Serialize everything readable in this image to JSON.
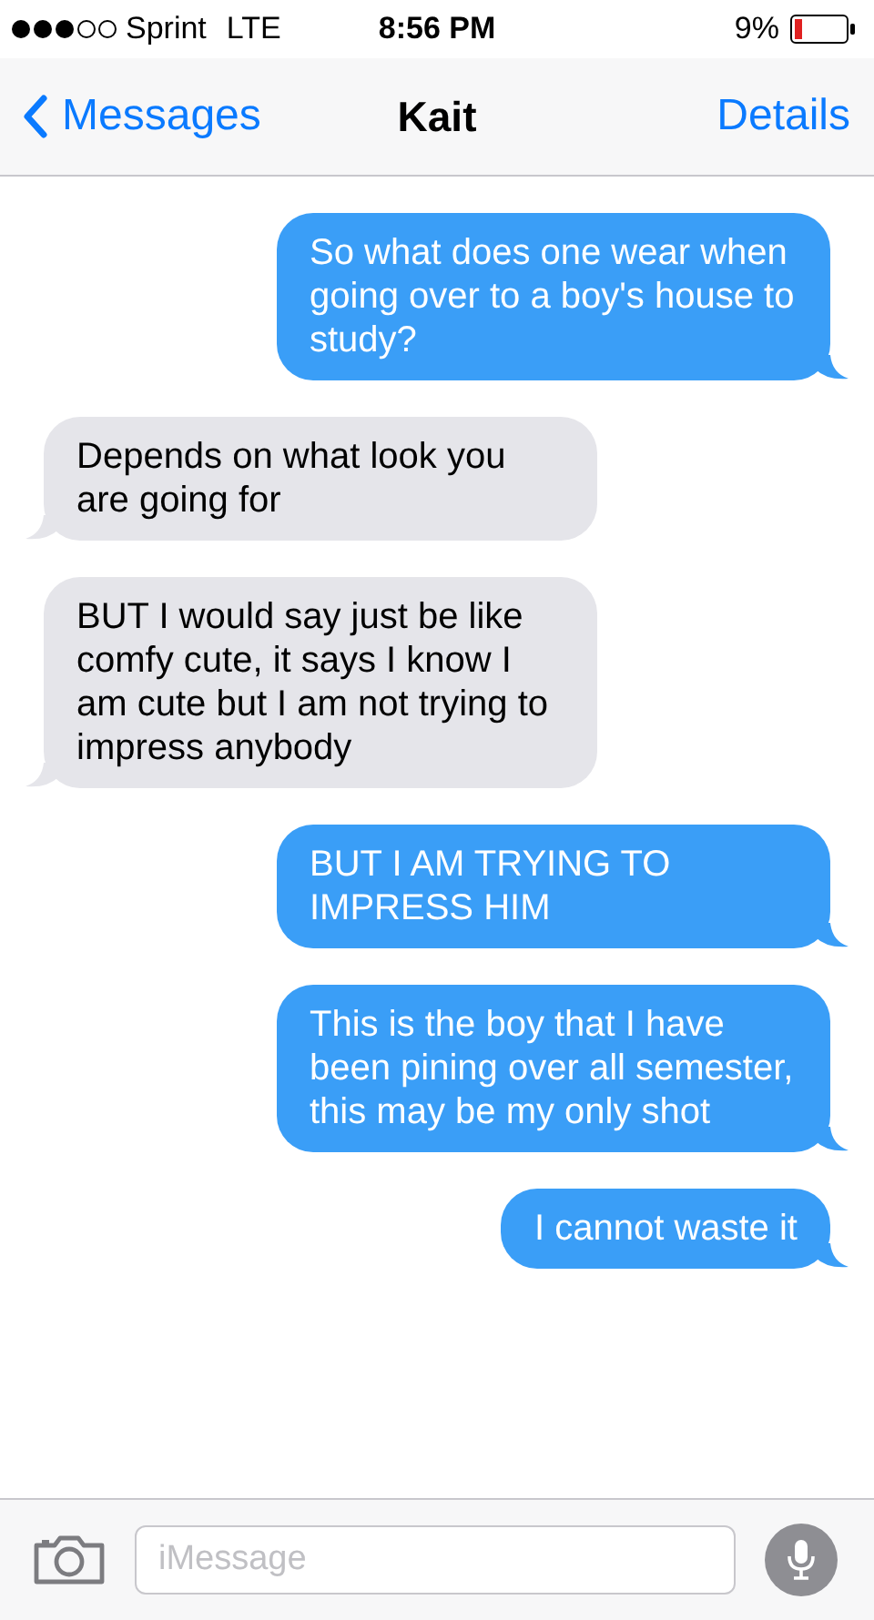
{
  "status_bar": {
    "carrier": "Sprint",
    "network": "LTE",
    "time": "8:56 PM",
    "battery": "9%"
  },
  "nav": {
    "back": "Messages",
    "title": "Kait",
    "action": "Details"
  },
  "messages": [
    {
      "kind": "sent",
      "text": "So what does one wear when going over to a boy's house to study?"
    },
    {
      "kind": "received",
      "text": "Depends on what look you are going for"
    },
    {
      "kind": "received",
      "text": "BUT I would say just be like comfy cute, it says I know I am cute but I am not trying to impress anybody"
    },
    {
      "kind": "sent",
      "text": "BUT I AM TRYING TO IMPRESS HIM"
    },
    {
      "kind": "sent",
      "text": "This is the boy that I have been pining over all semester, this may be my only shot"
    },
    {
      "kind": "sent",
      "text": "I cannot waste it"
    }
  ],
  "composer": {
    "placeholder": "iMessage"
  }
}
